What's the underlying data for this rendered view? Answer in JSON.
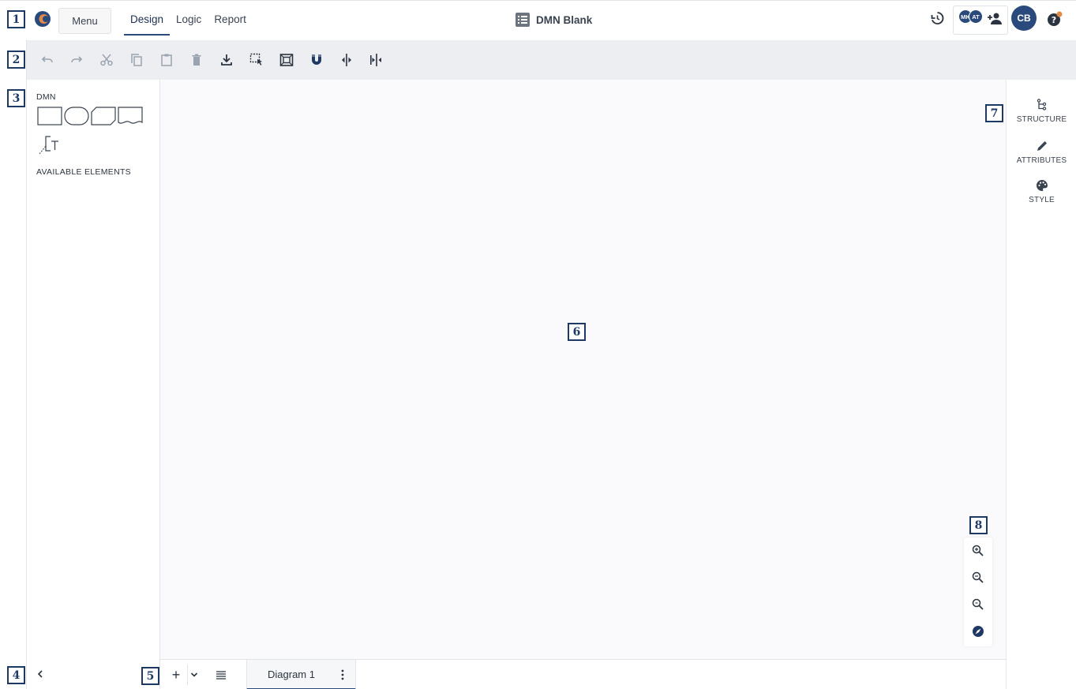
{
  "header": {
    "menu_label": "Menu",
    "tabs": [
      {
        "label": "Design",
        "active": true
      },
      {
        "label": "Logic",
        "active": false
      },
      {
        "label": "Report",
        "active": false
      }
    ],
    "doc_title": "DMN Blank",
    "collaborators": [
      "MK",
      "AT"
    ],
    "user_initials": "CB",
    "icons": [
      "history-icon",
      "add-user-icon",
      "help-icon"
    ],
    "accent_color": "#2b4a7c",
    "notification_color": "#e08a4a"
  },
  "toolbar": {
    "items": [
      "undo",
      "redo",
      "cut",
      "copy",
      "paste",
      "delete",
      "download",
      "select-area",
      "fit-to-frame",
      "snap-magnet",
      "distribute-horizontal",
      "distribute-spacing"
    ]
  },
  "palette": {
    "heading": "DMN",
    "shapes": [
      "decision",
      "input-data",
      "knowledge-source",
      "business-knowledge-model",
      "text-annotation"
    ],
    "available_heading": "AVAILABLE ELEMENTS"
  },
  "right_panel": {
    "items": [
      {
        "label": "STRUCTURE",
        "icon": "structure-icon"
      },
      {
        "label": "ATTRIBUTES",
        "icon": "pencil-icon"
      },
      {
        "label": "STYLE",
        "icon": "palette-icon"
      }
    ]
  },
  "zoom": {
    "buttons": [
      "zoom-in",
      "zoom-out",
      "zoom-reset",
      "navigator"
    ]
  },
  "bottombar": {
    "add_label": "+",
    "diagram_tab": "Diagram 1"
  },
  "markers": [
    "1",
    "2",
    "3",
    "4",
    "5",
    "6",
    "7",
    "8"
  ]
}
